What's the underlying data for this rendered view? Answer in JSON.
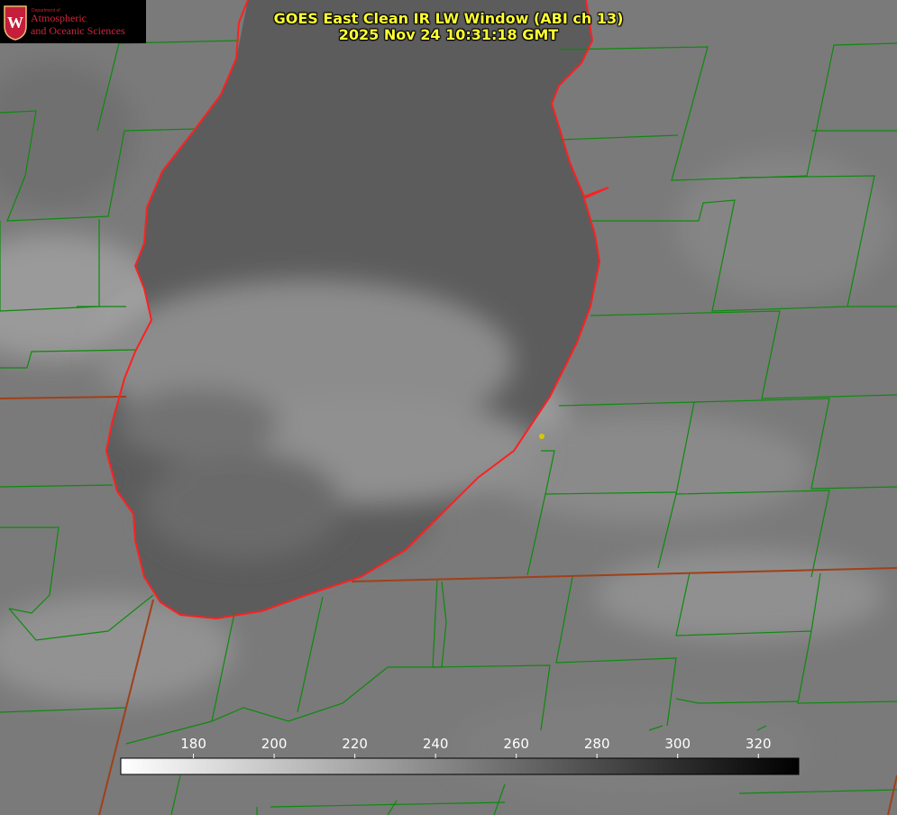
{
  "title": {
    "line1": "GOES East Clean IR LW Window (ABI ch 13)",
    "line2": "2025 Nov 24 10:31:18 GMT"
  },
  "logo": {
    "dept": "Department of",
    "line1": "Atmospheric",
    "line2": "and Oceanic Sciences",
    "seal_letter": "W"
  },
  "colorbar": {
    "min": 162,
    "max": 330,
    "ticks": [
      "180",
      "200",
      "220",
      "240",
      "260",
      "280",
      "300",
      "320"
    ],
    "tick_values": [
      180,
      200,
      220,
      240,
      260,
      280,
      300,
      320
    ],
    "gradient_from": "#ffffff",
    "gradient_to": "#000000"
  },
  "colors": {
    "title": "#ffff33",
    "lake_shore": "#ff2020",
    "county_lines": "#0d8a0d",
    "state_lines": "#a0401a",
    "marker": "#d8c800",
    "lake_fill": "#5a5a5a",
    "land_fill": "#7c7c7c",
    "cloud_fill": "#9a9a9a"
  }
}
